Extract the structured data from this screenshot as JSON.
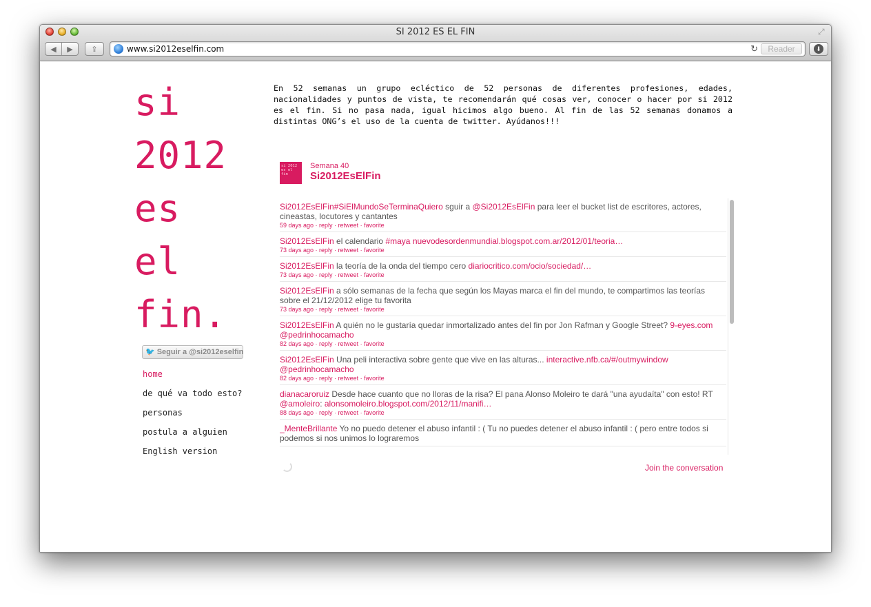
{
  "browser": {
    "window_title": "SI 2012 ES EL FIN",
    "url": "www.si2012eselfin.com",
    "reader_label": "Reader",
    "back_glyph": "◀",
    "forward_glyph": "▶",
    "share_glyph": "⇪",
    "reload_glyph": "↻",
    "download_glyph": "⬇",
    "resize_glyph": "⤢"
  },
  "logo": {
    "lines": [
      "si",
      "2012",
      "es",
      "el",
      "fin."
    ]
  },
  "follow_button": {
    "bird": "🐦",
    "label": "Seguir a @si2012eselfin"
  },
  "nav": {
    "items": [
      {
        "label": "home",
        "active": true
      },
      {
        "label": "de qué va todo esto?"
      },
      {
        "label": "personas"
      },
      {
        "label": "postula a alguien"
      },
      {
        "label": "English version"
      }
    ]
  },
  "intro": "En 52 semanas un grupo ecléctico de 52 personas de diferentes profesiones, edades, nacionalidades y puntos de vista, te recomendarán qué cosas ver, conocer o hacer por si 2012 es el fin. Si no pasa nada, igual hicimos algo bueno. Al fin de las 52 semanas donamos a distintas ONG’s el uso de la cuenta de twitter. Ayúdanos!!!",
  "widget": {
    "avatar_text": "si 2012 es el fin",
    "week": "Semana 40",
    "account": "Si2012EsElFin",
    "join_label": "Join the conversation",
    "tweets": [
      {
        "user": "Si2012EsElFin",
        "parts": [
          {
            "t": "#SiElMundoSeTerminaQuiero",
            "link": true
          },
          {
            "t": " sguir a "
          },
          {
            "t": "@Si2012EsElFin",
            "link": true
          },
          {
            "t": " para leer el bucket list de escritores, actores, cineastas, locutores y cantantes"
          }
        ],
        "time": "59 days ago"
      },
      {
        "user": "Si2012EsElFin",
        "parts": [
          {
            "t": " el calendario "
          },
          {
            "t": "#maya",
            "link": true
          },
          {
            "t": " "
          },
          {
            "t": "nuevodesordenmundial.blogspot.com.ar/2012/01/teoria…",
            "link": true
          }
        ],
        "time": "73 days ago"
      },
      {
        "user": "Si2012EsElFin",
        "parts": [
          {
            "t": " la teoría de la onda del tiempo cero "
          },
          {
            "t": "diariocritico.com/ocio/sociedad/…",
            "link": true
          }
        ],
        "time": "73 days ago"
      },
      {
        "user": "Si2012EsElFin",
        "parts": [
          {
            "t": " a sólo semanas de la fecha que según los Mayas marca el fin del mundo, te compartimos las teorías sobre el 21/12/2012 elige tu favorita"
          }
        ],
        "time": "73 days ago"
      },
      {
        "user": "Si2012EsElFin",
        "parts": [
          {
            "t": " A quién no le gustaría quedar inmortalizado antes del fin por Jon Rafman y Google Street? "
          },
          {
            "t": "9-eyes.com",
            "link": true
          },
          {
            "t": " "
          },
          {
            "t": "@pedrinhocamacho",
            "link": true
          }
        ],
        "time": "82 days ago"
      },
      {
        "user": "Si2012EsElFin",
        "parts": [
          {
            "t": " Una peli interactiva sobre gente que vive en las alturas... "
          },
          {
            "t": "interactive.nfb.ca/#/outmywindow",
            "link": true
          },
          {
            "t": " "
          },
          {
            "t": "@pedrinhocamacho",
            "link": true
          }
        ],
        "time": "82 days ago"
      },
      {
        "user": "dianacaroruiz",
        "parts": [
          {
            "t": " Desde hace cuanto que no lloras de la risa? El pana Alonso Moleiro te dará \"una ayudaíta\" con esto! RT "
          },
          {
            "t": "@amoleiro",
            "link": true
          },
          {
            "t": ": "
          },
          {
            "t": "alonsomoleiro.blogspot.com/2012/11/manifi…",
            "link": true
          }
        ],
        "time": "88 days ago"
      },
      {
        "user": "_MenteBrillante",
        "parts": [
          {
            "t": " Yo no puedo detener el abuso infantil : ( Tu no puedes detener el abuso infantil : ( pero entre todos si podemos si nos unimos lo lograremos"
          }
        ],
        "time": ""
      }
    ],
    "actions": [
      "reply",
      "retweet",
      "favorite"
    ]
  },
  "colors": {
    "accent": "#d81b60",
    "text": "#555555"
  }
}
